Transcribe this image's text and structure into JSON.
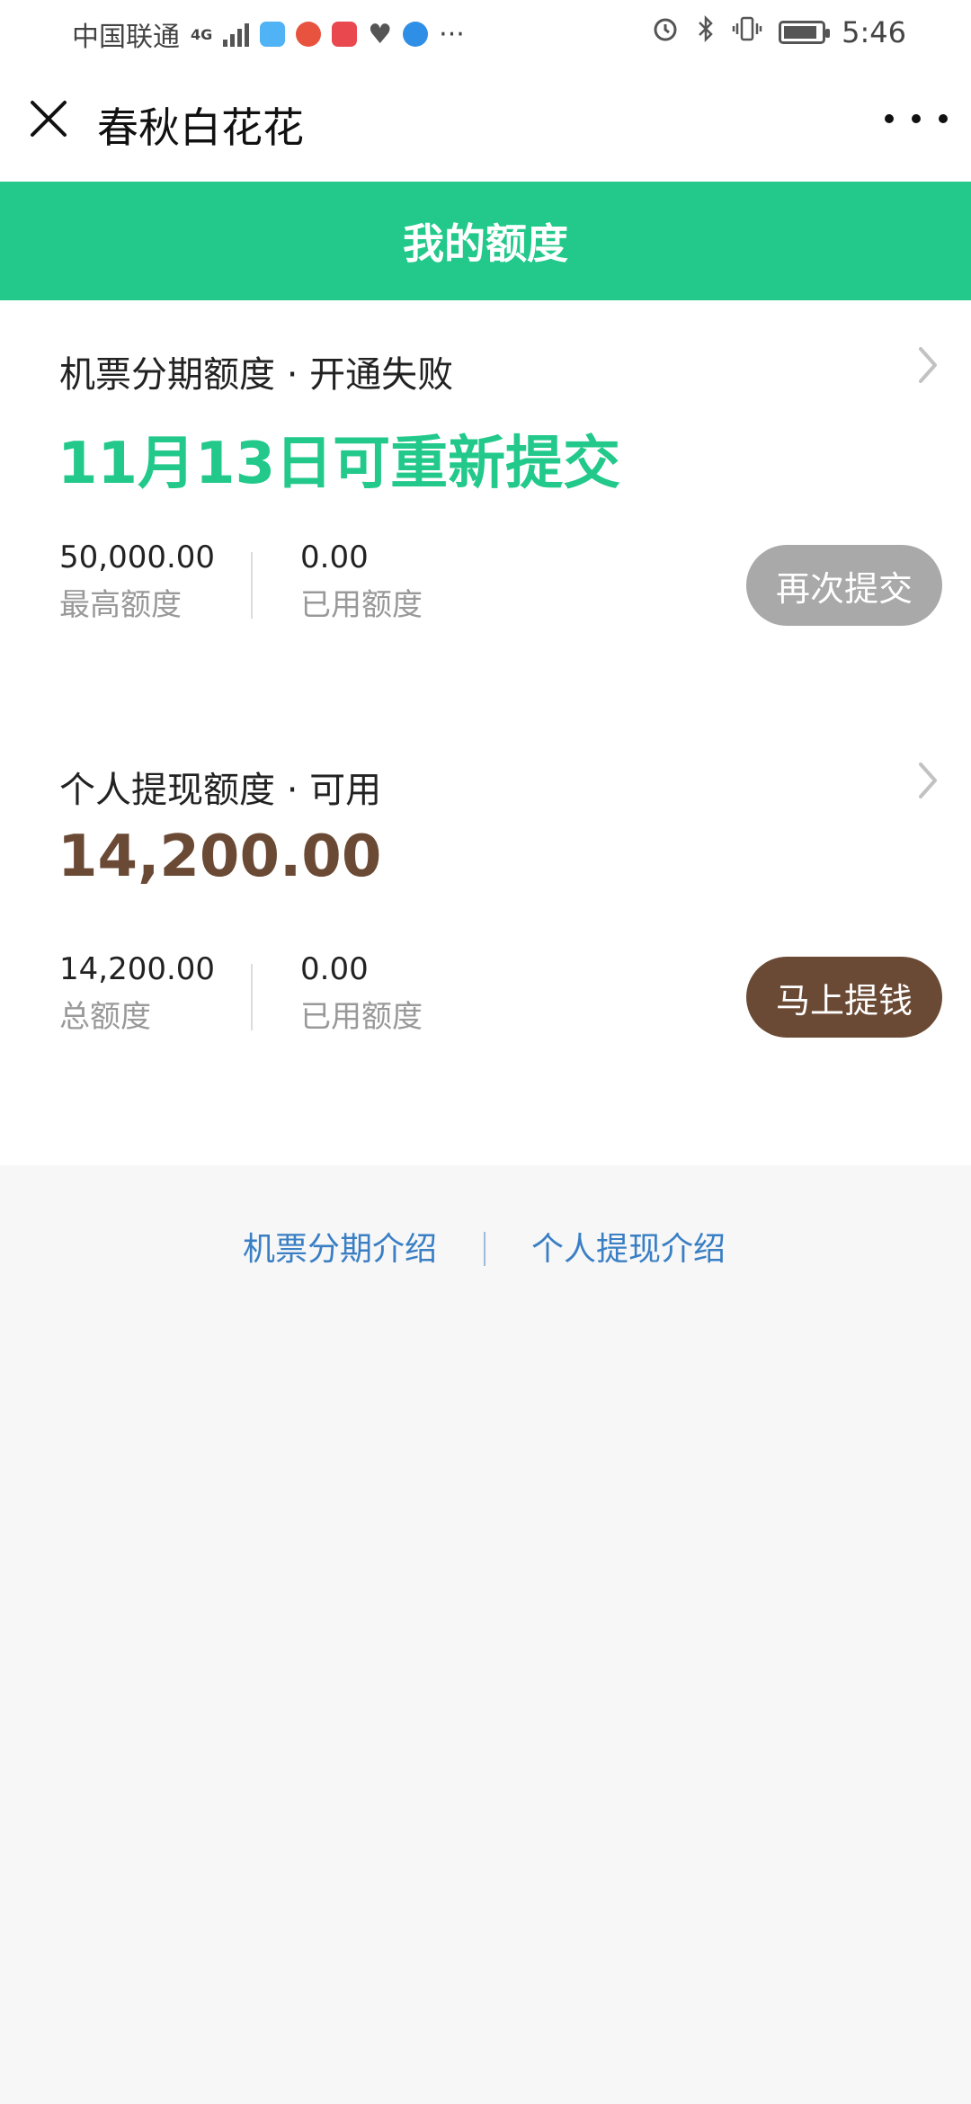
{
  "status_bar": {
    "carrier": "中国联通",
    "network": "4G",
    "more": "···",
    "time": "5:46"
  },
  "nav": {
    "title": "春秋白花花"
  },
  "header": {
    "title": "我的额度"
  },
  "sections": [
    {
      "title": "机票分期额度 · 开通失败",
      "headline": "11月13日可重新提交",
      "headline_color": "#22c98b",
      "stat1_value": "50,000.00",
      "stat1_label": "最高额度",
      "stat2_value": "0.00",
      "stat2_label": "已用额度",
      "button_label": "再次提交",
      "button_color": "#a9a9a9"
    },
    {
      "title": "个人提现额度 · 可用",
      "headline": "14,200.00",
      "headline_color": "#6b4a35",
      "stat1_value": "14,200.00",
      "stat1_label": "总额度",
      "stat2_value": "0.00",
      "stat2_label": "已用额度",
      "button_label": "马上提钱",
      "button_color": "#6b4a35"
    }
  ],
  "footer": {
    "link1": "机票分期介绍",
    "link2": "个人提现介绍"
  }
}
